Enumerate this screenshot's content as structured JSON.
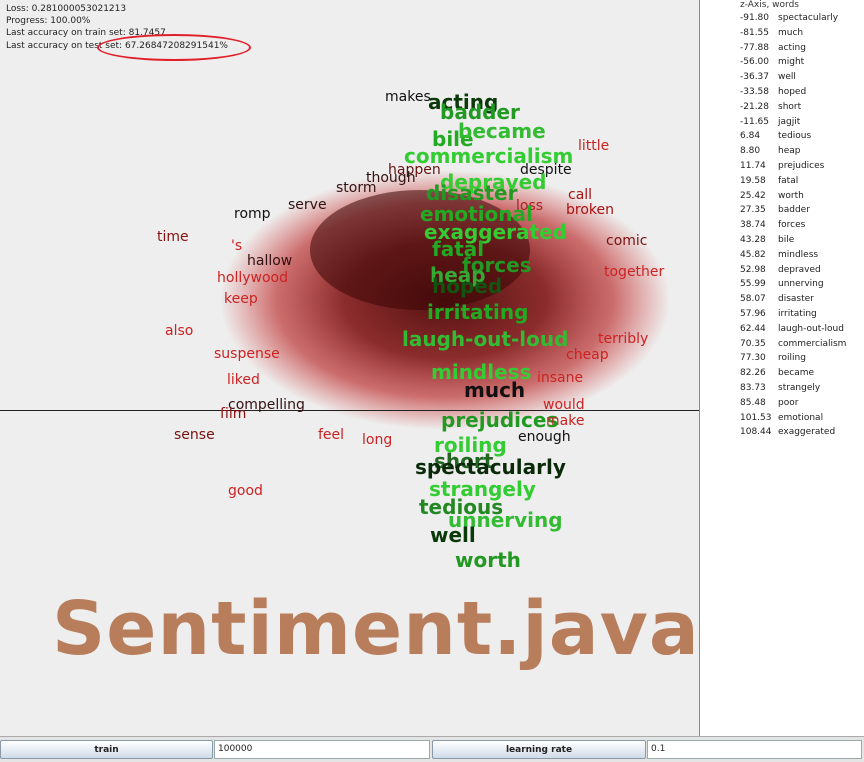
{
  "status": {
    "loss": "Loss: 0.281000053021213",
    "progress": "Progress: 100.00%",
    "train_acc": "Last accuracy on train set: 81.7457",
    "test_acc": "Last accuracy on test set: 67.26847208291541%"
  },
  "watermark": "Sentiment.java",
  "side": {
    "header": "z-Axis, words",
    "rows": [
      {
        "v": "-91.80",
        "w": "spectacularly"
      },
      {
        "v": "-81.55",
        "w": "much"
      },
      {
        "v": "-77.88",
        "w": "acting"
      },
      {
        "v": "-56.00",
        "w": "might"
      },
      {
        "v": "-36.37",
        "w": "well"
      },
      {
        "v": "-33.58",
        "w": "hoped"
      },
      {
        "v": "-21.28",
        "w": "short"
      },
      {
        "v": "-11.65",
        "w": "jagjit"
      },
      {
        "v": "6.84",
        "w": "tedious"
      },
      {
        "v": "8.80",
        "w": "heap"
      },
      {
        "v": "11.74",
        "w": "prejudices"
      },
      {
        "v": "19.58",
        "w": "fatal"
      },
      {
        "v": "25.42",
        "w": "worth"
      },
      {
        "v": "27.35",
        "w": "badder"
      },
      {
        "v": "38.74",
        "w": "forces"
      },
      {
        "v": "43.28",
        "w": "bile"
      },
      {
        "v": "45.82",
        "w": "mindless"
      },
      {
        "v": "52.98",
        "w": "depraved"
      },
      {
        "v": "55.99",
        "w": "unnerving"
      },
      {
        "v": "58.07",
        "w": "disaster"
      },
      {
        "v": "57.96",
        "w": "irritating"
      },
      {
        "v": "62.44",
        "w": "laugh-out-loud"
      },
      {
        "v": "70.35",
        "w": "commercialism"
      },
      {
        "v": "77.30",
        "w": "roiling"
      },
      {
        "v": "82.26",
        "w": "became"
      },
      {
        "v": "83.73",
        "w": "strangely"
      },
      {
        "v": "85.48",
        "w": "poor"
      },
      {
        "v": "101.53",
        "w": "emotional"
      },
      {
        "v": "108.44",
        "w": "exaggerated"
      }
    ]
  },
  "controls": {
    "train_label": "train",
    "train_value": "100000",
    "lr_label": "learning rate",
    "lr_value": "0.1"
  },
  "words": [
    {
      "t": "makes",
      "c": "#111111",
      "s": 14,
      "b": false
    },
    {
      "t": "acting",
      "c": "#0a3a0a",
      "s": 20,
      "b": true
    },
    {
      "t": "badder",
      "c": "#229922",
      "s": 20,
      "b": true
    },
    {
      "t": "bile",
      "c": "#22aa22",
      "s": 20,
      "b": true
    },
    {
      "t": "became",
      "c": "#33bb33",
      "s": 20,
      "b": true
    },
    {
      "t": "little",
      "c": "#cc2222",
      "s": 14,
      "b": false
    },
    {
      "t": "commercialism",
      "c": "#33cc33",
      "s": 20,
      "b": true
    },
    {
      "t": "happen",
      "c": "#661111",
      "s": 14,
      "b": false
    },
    {
      "t": "though",
      "c": "#331111",
      "s": 14,
      "b": false
    },
    {
      "t": "despite",
      "c": "#111111",
      "s": 14,
      "b": false
    },
    {
      "t": "depraved",
      "c": "#33cc33",
      "s": 20,
      "b": true
    },
    {
      "t": "disaster",
      "c": "#229922",
      "s": 20,
      "b": true
    },
    {
      "t": "storm",
      "c": "#331111",
      "s": 14,
      "b": false
    },
    {
      "t": "call",
      "c": "#aa1111",
      "s": 14,
      "b": false
    },
    {
      "t": "serve",
      "c": "#331111",
      "s": 14,
      "b": false
    },
    {
      "t": "loss",
      "c": "#aa2222",
      "s": 14,
      "b": false
    },
    {
      "t": "broken",
      "c": "#aa1111",
      "s": 14,
      "b": false
    },
    {
      "t": "emotional",
      "c": "#22aa22",
      "s": 20,
      "b": true
    },
    {
      "t": "romp",
      "c": "#111111",
      "s": 14,
      "b": false
    },
    {
      "t": "time",
      "c": "#881111",
      "s": 14,
      "b": false
    },
    {
      "t": "exaggerated",
      "c": "#33cc33",
      "s": 20,
      "b": true
    },
    {
      "t": "comic",
      "c": "#771111",
      "s": 14,
      "b": false
    },
    {
      "t": "'s",
      "c": "#cc2222",
      "s": 14,
      "b": false
    },
    {
      "t": "fatal",
      "c": "#22aa22",
      "s": 20,
      "b": true
    },
    {
      "t": "hallow",
      "c": "#331111",
      "s": 14,
      "b": false
    },
    {
      "t": "forces",
      "c": "#229922",
      "s": 20,
      "b": true
    },
    {
      "t": "together",
      "c": "#cc2222",
      "s": 14,
      "b": false
    },
    {
      "t": "hollywood",
      "c": "#cc2222",
      "s": 14,
      "b": false
    },
    {
      "t": "heap",
      "c": "#33aa33",
      "s": 20,
      "b": true
    },
    {
      "t": "hoped",
      "c": "#115511",
      "s": 20,
      "b": true
    },
    {
      "t": "keep",
      "c": "#cc2222",
      "s": 14,
      "b": false
    },
    {
      "t": "also",
      "c": "#cc2222",
      "s": 14,
      "b": false
    },
    {
      "t": "irritating",
      "c": "#22aa22",
      "s": 20,
      "b": true
    },
    {
      "t": "laugh-out-loud",
      "c": "#33bb33",
      "s": 20,
      "b": true
    },
    {
      "t": "terribly",
      "c": "#cc2222",
      "s": 14,
      "b": false
    },
    {
      "t": "suspense",
      "c": "#cc2222",
      "s": 14,
      "b": false
    },
    {
      "t": "mindless",
      "c": "#33cc33",
      "s": 20,
      "b": true
    },
    {
      "t": "cheap",
      "c": "#cc2222",
      "s": 14,
      "b": false
    },
    {
      "t": "liked",
      "c": "#cc2222",
      "s": 14,
      "b": false
    },
    {
      "t": "much",
      "c": "#111111",
      "s": 20,
      "b": true
    },
    {
      "t": "insane",
      "c": "#cc2222",
      "s": 14,
      "b": false
    },
    {
      "t": "compelling",
      "c": "#331111",
      "s": 14,
      "b": false
    },
    {
      "t": "would",
      "c": "#cc2222",
      "s": 14,
      "b": false
    },
    {
      "t": "film",
      "c": "#881111",
      "s": 14,
      "b": false
    },
    {
      "t": "prejudices",
      "c": "#229922",
      "s": 20,
      "b": true
    },
    {
      "t": "make",
      "c": "#cc2222",
      "s": 14,
      "b": false
    },
    {
      "t": "sense",
      "c": "#771111",
      "s": 14,
      "b": false
    },
    {
      "t": "feel",
      "c": "#cc2222",
      "s": 14,
      "b": false
    },
    {
      "t": "enough",
      "c": "#111111",
      "s": 14,
      "b": false
    },
    {
      "t": "long",
      "c": "#cc2222",
      "s": 14,
      "b": false
    },
    {
      "t": "roiling",
      "c": "#33cc33",
      "s": 20,
      "b": true
    },
    {
      "t": "short",
      "c": "#226622",
      "s": 20,
      "b": true
    },
    {
      "t": "spectacularly",
      "c": "#0a2a0a",
      "s": 20,
      "b": true
    },
    {
      "t": "good",
      "c": "#cc2222",
      "s": 14,
      "b": false
    },
    {
      "t": "strangely",
      "c": "#33cc33",
      "s": 20,
      "b": true
    },
    {
      "t": "tedious",
      "c": "#228822",
      "s": 20,
      "b": true
    },
    {
      "t": "unnerving",
      "c": "#33bb33",
      "s": 20,
      "b": true
    },
    {
      "t": "well",
      "c": "#0a3a0a",
      "s": 20,
      "b": true
    },
    {
      "t": "worth",
      "c": "#229922",
      "s": 20,
      "b": true
    }
  ]
}
